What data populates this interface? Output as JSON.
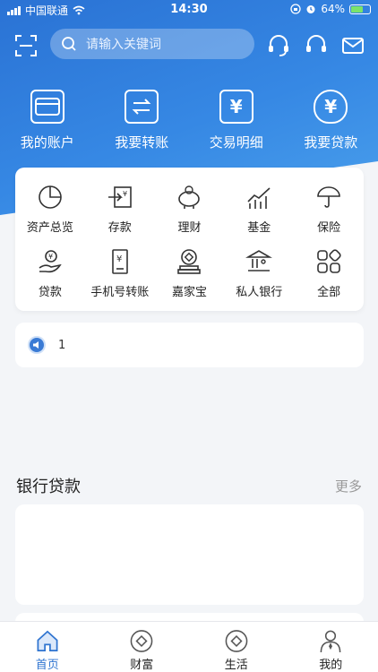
{
  "status": {
    "carrier": "中国联通",
    "time": "14:30",
    "battery": "64%"
  },
  "search": {
    "placeholder": "请输入关键词"
  },
  "quick": [
    {
      "label": "我的账户",
      "icon": "card-icon"
    },
    {
      "label": "我要转账",
      "icon": "transfer-icon"
    },
    {
      "label": "交易明细",
      "icon": "yuan-doc-icon"
    },
    {
      "label": "我要贷款",
      "icon": "money-bag-icon"
    }
  ],
  "grid": [
    {
      "label": "资产总览",
      "icon": "pie-chart-icon"
    },
    {
      "label": "存款",
      "icon": "deposit-icon"
    },
    {
      "label": "理财",
      "icon": "piggy-bank-icon"
    },
    {
      "label": "基金",
      "icon": "trend-chart-icon"
    },
    {
      "label": "保险",
      "icon": "umbrella-icon"
    },
    {
      "label": "贷款",
      "icon": "hand-coin-icon"
    },
    {
      "label": "手机号转账",
      "icon": "phone-transfer-icon"
    },
    {
      "label": "嘉家宝",
      "icon": "coin-stack-icon"
    },
    {
      "label": "私人银行",
      "icon": "bank-icon"
    },
    {
      "label": "全部",
      "icon": "all-apps-icon"
    }
  ],
  "notice": {
    "text": "1"
  },
  "loans": {
    "title": "银行贷款",
    "more": "更多"
  },
  "tabs": [
    {
      "label": "首页",
      "icon": "home-icon",
      "active": true
    },
    {
      "label": "财富",
      "icon": "wealth-icon",
      "active": false
    },
    {
      "label": "生活",
      "icon": "life-icon",
      "active": false
    },
    {
      "label": "我的",
      "icon": "profile-icon",
      "active": false
    }
  ],
  "colors": {
    "primary": "#2f74d0",
    "background": "#f3f5f8"
  }
}
